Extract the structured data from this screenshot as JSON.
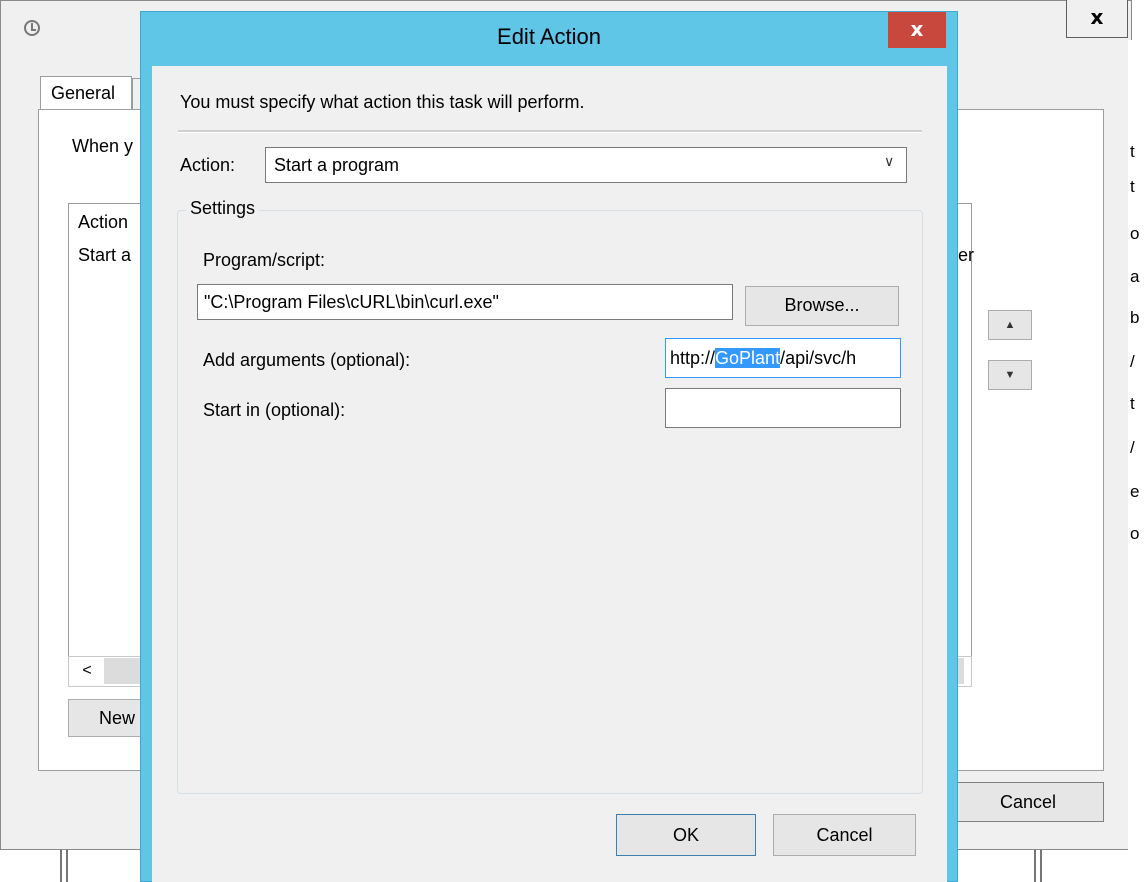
{
  "background_window": {
    "tab_general": "General",
    "when_text": "When y",
    "list_header": "Action",
    "list_row": "Start a",
    "list_row_tail": "er",
    "scroll_left": "<",
    "new_button": "New",
    "cancel_button": "Cancel",
    "close_glyph": "x",
    "up_arrow": "▲",
    "down_arrow": "▼",
    "right_edge_chars": [
      "t",
      "t",
      "o",
      "a",
      "b",
      "/",
      "t",
      "/",
      "e",
      "o"
    ]
  },
  "dialog": {
    "title": "Edit Action",
    "close_glyph": "x",
    "instruction": "You must specify what action this task will perform.",
    "action_label": "Action:",
    "action_value": "Start a program",
    "dropdown_arrow": "∨",
    "settings_legend": "Settings",
    "program_label": "Program/script:",
    "program_value": "\"C:\\Program Files\\cURL\\bin\\curl.exe\"",
    "browse_button": "Browse...",
    "arguments_label": "Add arguments (optional):",
    "arguments_prefix": "http://",
    "arguments_selected": "GoPlant",
    "arguments_suffix": "/api/svc/h",
    "start_in_label": "Start in (optional):",
    "start_in_value": "",
    "ok_button": "OK",
    "cancel_button": "Cancel"
  },
  "colors": {
    "title_bar": "#5fc6e8",
    "close_button": "#c9483d",
    "selection": "#3399ff"
  }
}
